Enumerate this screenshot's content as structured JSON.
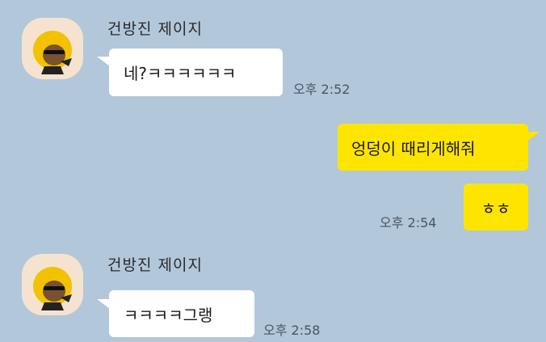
{
  "messages": [
    {
      "sender": "건방진 제이지",
      "text": "네?ㅋㅋㅋㅋㅋㅋ",
      "time": "오후 2:52"
    },
    {
      "text": "엉덩이 때리게해줘"
    },
    {
      "text": "ㅎㅎ",
      "time": "오후 2:54"
    },
    {
      "sender": "건방진 제이지",
      "text": "ㅋㅋㅋㅋ그랭",
      "time": "오후 2:58"
    }
  ],
  "avatar_icon": "jay-g-profile-icon",
  "colors": {
    "background": "#b2c7da",
    "incoming": "#ffffff",
    "outgoing": "#fee500"
  }
}
